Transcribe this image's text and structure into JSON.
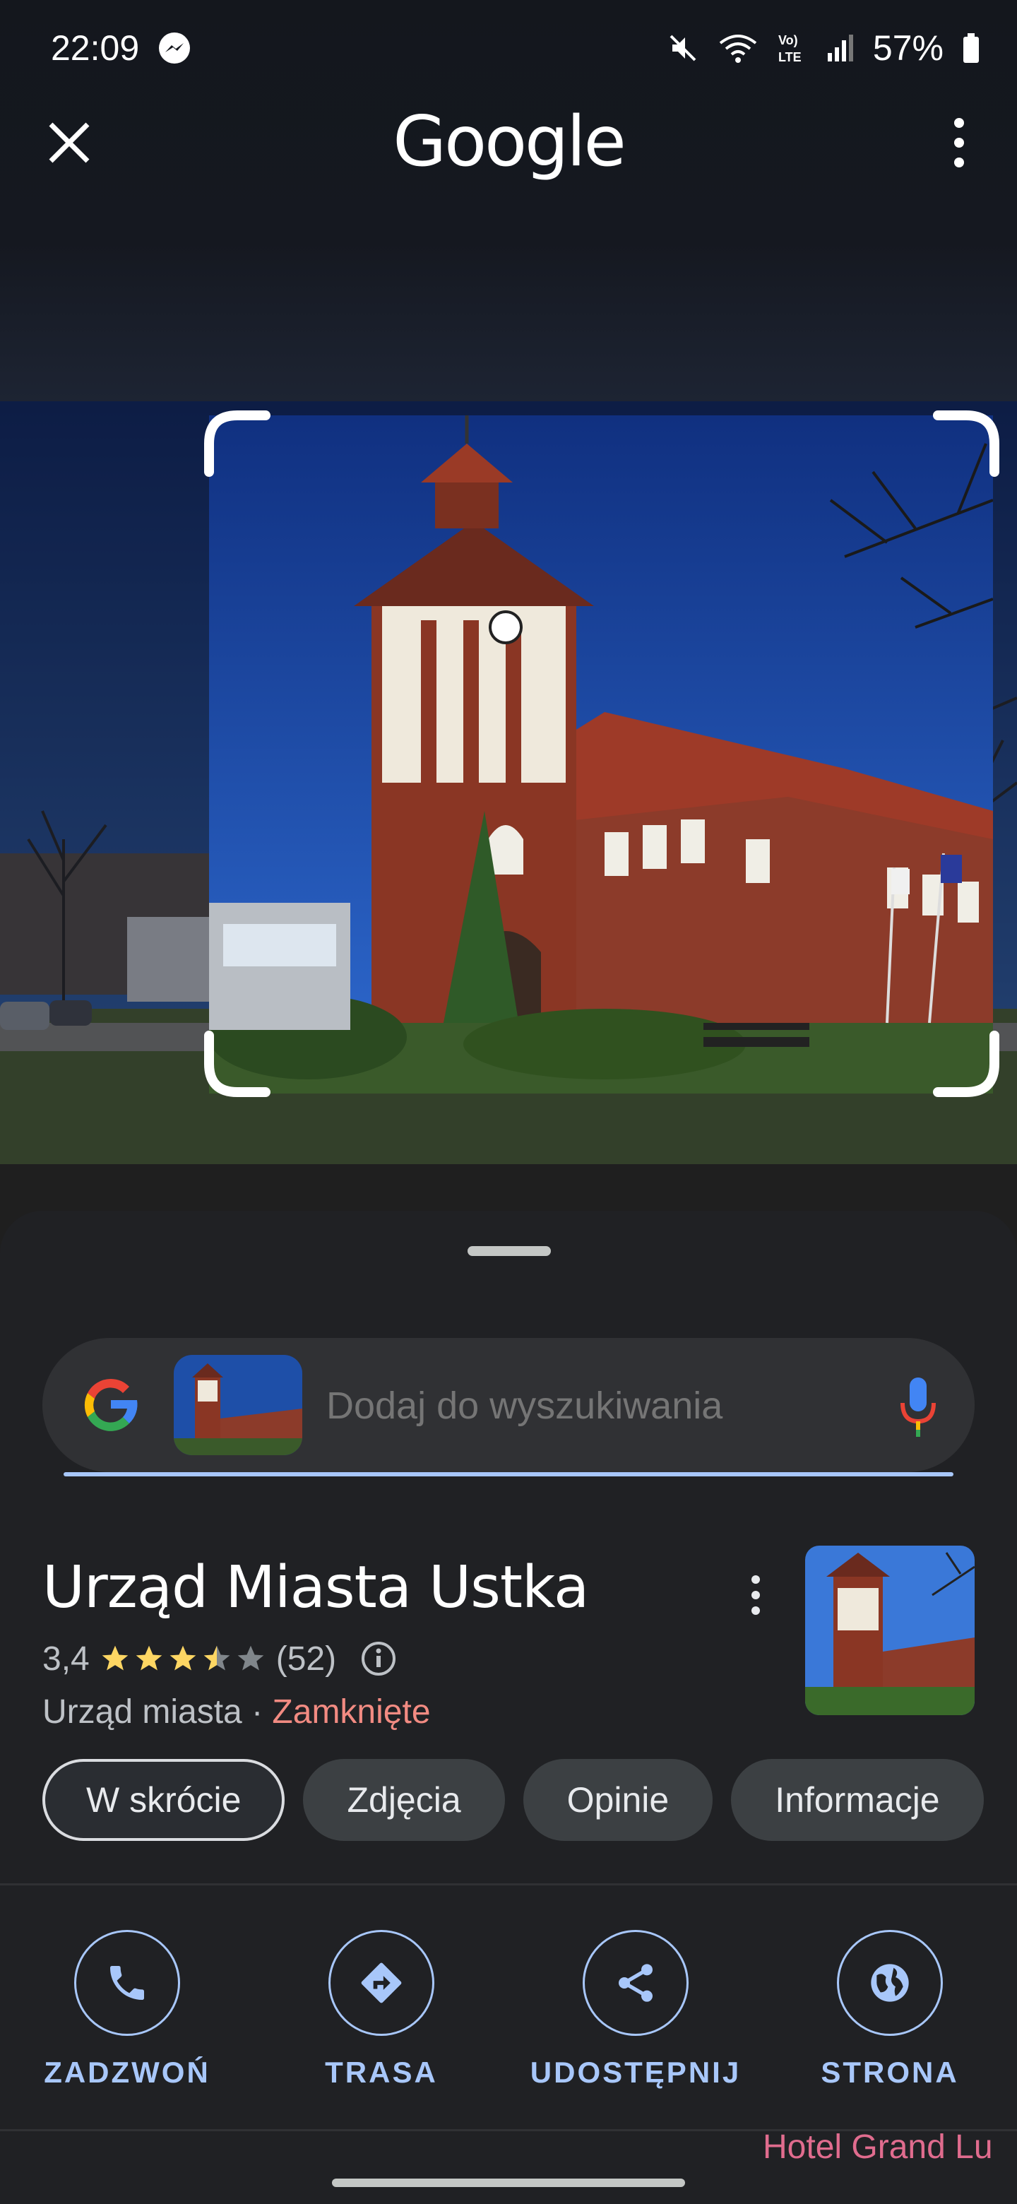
{
  "status_bar": {
    "time": "22:09",
    "battery": "57%",
    "icons": [
      "messenger-icon",
      "mute-icon",
      "wifi-icon",
      "volte-icon",
      "signal-icon",
      "battery-icon"
    ]
  },
  "header": {
    "logo_text": "Google",
    "close_icon": "close-icon",
    "menu_icon": "more-vert-icon"
  },
  "search": {
    "placeholder": "Dodaj do wyszukiwania",
    "mic_icon": "mic-icon"
  },
  "place": {
    "name": "Urząd Miasta Ustka",
    "rating": "3,4",
    "rating_value": 3.4,
    "review_count": "(52)",
    "category": "Urząd miasta",
    "separator": "·",
    "status": "Zamknięte"
  },
  "tabs": [
    {
      "label": "W skrócie",
      "active": true
    },
    {
      "label": "Zdjęcia",
      "active": false
    },
    {
      "label": "Opinie",
      "active": false
    },
    {
      "label": "Informacje",
      "active": false
    }
  ],
  "actions": [
    {
      "label": "ZADZWOŃ",
      "icon": "phone-icon"
    },
    {
      "label": "TRASA",
      "icon": "directions-icon"
    },
    {
      "label": "UDOSTĘPNIJ",
      "icon": "share-icon"
    },
    {
      "label": "STRONA",
      "icon": "globe-icon"
    }
  ],
  "peek_text": "Hotel Grand Lu",
  "colors": {
    "accent": "#a8c7fa",
    "closed": "#f28b82",
    "star": "#fdd663"
  }
}
